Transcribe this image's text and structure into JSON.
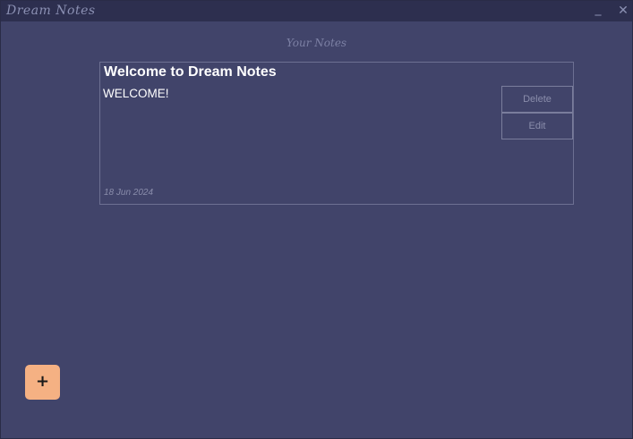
{
  "window": {
    "title": "Dream Notes",
    "minimize_label": "_",
    "close_label": "✕"
  },
  "main": {
    "heading": "Your Notes",
    "notes": [
      {
        "title": "Welcome to Dream Notes",
        "body": "WELCOME!",
        "date": "18 Jun 2024",
        "delete_label": "Delete",
        "edit_label": "Edit"
      }
    ],
    "add_button_label": "+"
  },
  "colors": {
    "background": "#41446a",
    "titlebar": "#2d2f4f",
    "accent": "#f5b183"
  }
}
